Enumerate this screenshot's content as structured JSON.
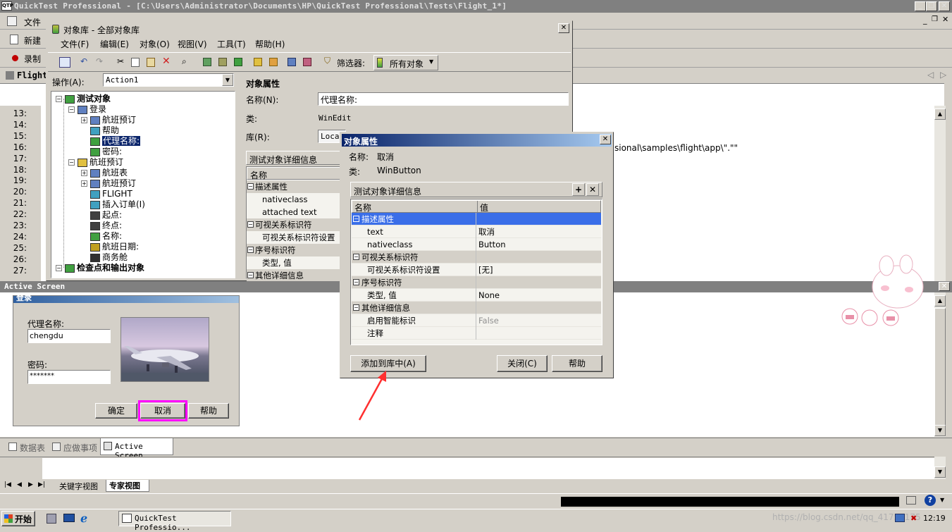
{
  "main": {
    "title": "QuickTest Professional - [C:\\Users\\Administrator\\Documents\\HP\\QuickTest Professional\\Tests\\Flight_1*]",
    "menu_file": "文件",
    "toolbar_new": "新建",
    "toolbar_record": "录制",
    "tab_test": "Flight"
  },
  "editor": {
    "line_numbers": [
      "13:",
      "14:",
      "15:",
      "16:",
      "17:",
      "18:",
      "19:",
      "20:",
      "21:",
      "22:",
      "23:",
      "24:",
      "25:",
      "26:",
      "27:"
    ],
    "code_fragment": "sional\\samples\\flight\\app\\\".\"\""
  },
  "repo": {
    "title": "对象库 - 全部对象库",
    "menu": [
      "文件(F)",
      "编辑(E)",
      "对象(O)",
      "视图(V)",
      "工具(T)",
      "帮助(H)"
    ],
    "filter_label": "筛选器:",
    "filter_value": "所有对象",
    "action_label": "操作(A):",
    "action_value": "Action1",
    "tree": [
      {
        "label": "测试对象",
        "level": 0,
        "bold": true
      },
      {
        "label": "登录",
        "level": 1
      },
      {
        "label": "航班预订",
        "level": 2
      },
      {
        "label": "帮助",
        "level": 2
      },
      {
        "label": "代理名称:",
        "level": 2,
        "selected": true
      },
      {
        "label": "密码:",
        "level": 2
      },
      {
        "label": "航班预订",
        "level": 1
      },
      {
        "label": "航班表",
        "level": 2
      },
      {
        "label": "航班预订",
        "level": 2
      },
      {
        "label": "FLIGHT",
        "level": 2
      },
      {
        "label": "插入订单(I)",
        "level": 2
      },
      {
        "label": "起点:",
        "level": 2
      },
      {
        "label": "终点:",
        "level": 2
      },
      {
        "label": "名称:",
        "level": 2
      },
      {
        "label": "航班日期:",
        "level": 2
      },
      {
        "label": "商务舱",
        "level": 2
      },
      {
        "label": "检查点和输出对象",
        "level": 0,
        "bold": true
      }
    ],
    "props_header": "对象属性",
    "name_label": "名称(N):",
    "name_value": "代理名称:",
    "class_label": "类:",
    "class_value": "WinEdit",
    "lib_label": "库(R):",
    "lib_value": "Local",
    "details_header": "测试对象详细信息",
    "grid_header_name": "名称",
    "grid_rows": [
      "描述属性",
      "nativeclass",
      "attached text",
      "可视关系标识符",
      "可视关系标识符设置",
      "序号标识符",
      "类型, 值",
      "其他详细信息"
    ]
  },
  "dialog": {
    "title": "对象属性",
    "name_label": "名称:",
    "name_value": "取消",
    "class_label": "类:",
    "class_value": "WinButton",
    "details_header": "测试对象详细信息",
    "col_name": "名称",
    "col_value": "值",
    "rows": [
      {
        "name": "描述属性",
        "value": "",
        "group": true,
        "selected": true
      },
      {
        "name": "text",
        "value": "取消"
      },
      {
        "name": "nativeclass",
        "value": "Button"
      },
      {
        "name": "可视关系标识符",
        "value": "",
        "group": true
      },
      {
        "name": "可视关系标识符设置",
        "value": "[无]"
      },
      {
        "name": "序号标识符",
        "value": "",
        "group": true
      },
      {
        "name": "类型, 值",
        "value": "None"
      },
      {
        "name": "其他详细信息",
        "value": "",
        "group": true
      },
      {
        "name": "启用智能标识",
        "value": "False",
        "disabled": true
      },
      {
        "name": "注释",
        "value": ""
      }
    ],
    "add_button": "添加到库中(A)",
    "close_button": "关闭(C)",
    "help_button": "帮助"
  },
  "active_screen": {
    "header": "Active Screen",
    "login_title": "登录",
    "agent_label": "代理名称:",
    "agent_value": "chengdu",
    "password_label": "密码:",
    "password_value": "*******",
    "ok_button": "确定",
    "cancel_button": "取消",
    "help_button": "帮助"
  },
  "bottom_tabs": {
    "data_table": "数据表",
    "todo": "应做事项",
    "active_screen": "Active Screen",
    "keyword_view": "关键字视图",
    "expert_view": "专家视图"
  },
  "taskbar": {
    "start": "开始",
    "task": "QuickTest Professio...",
    "watermark": "https://blog.csdn.net/qq_41752175",
    "clock": "12:19"
  },
  "colors": {
    "selection": "#3a6ee8",
    "title_active_start": "#0a246a",
    "title_active_end": "#a6caf0",
    "highlight_box": "#ff00ff",
    "arrow": "#ff3030"
  }
}
